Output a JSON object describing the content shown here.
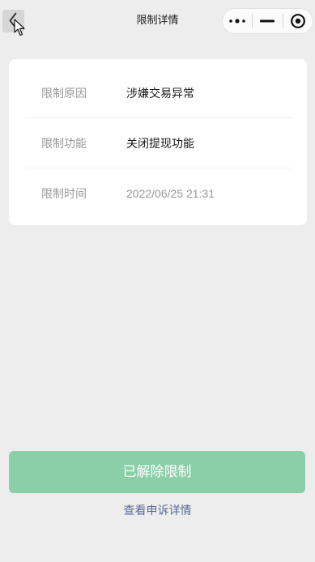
{
  "nav": {
    "title": "限制详情",
    "icons": {
      "back": "chevron-left-icon",
      "more": "more-dots-icon",
      "minimize": "minus-icon",
      "close": "target-circle-icon",
      "cursor": "mouse-cursor-icon"
    }
  },
  "details": {
    "rows": [
      {
        "label": "限制原因",
        "value": "涉嫌交易异常"
      },
      {
        "label": "限制功能",
        "value": "关闭提现功能"
      },
      {
        "label": "限制时间",
        "value": "2022/06/25 21:31"
      }
    ]
  },
  "actions": {
    "primary_label": "已解除限制",
    "link_label": "查看申诉详情"
  },
  "colors": {
    "background": "#EDEDED",
    "card": "#FFFFFF",
    "label": "#999999",
    "value": "#1A1A1A",
    "muted_value": "#999999",
    "divider": "#EEEEEE",
    "button": "#8ACFA8",
    "button_text": "#FFFFFF",
    "link": "#576B95"
  }
}
